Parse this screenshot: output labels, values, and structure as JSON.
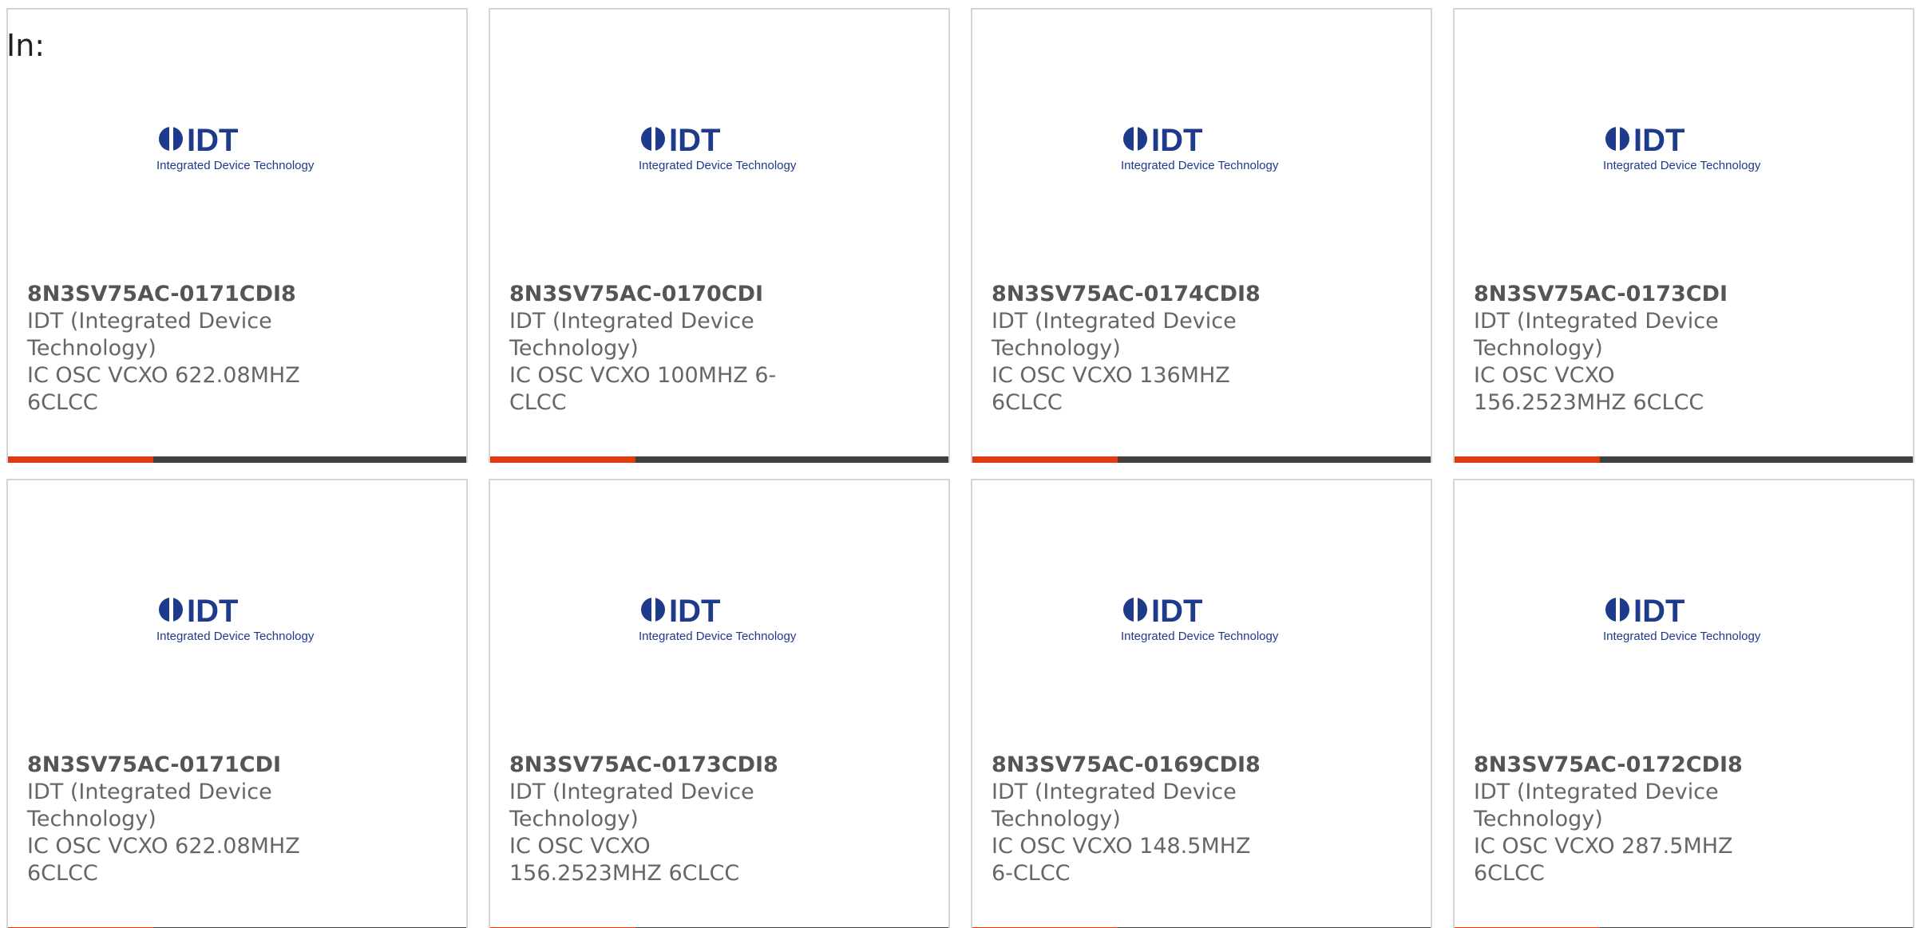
{
  "filter_label": "In:",
  "colors": {
    "accent": "#e03a10",
    "bar_dark": "#404040",
    "logo_blue": "#1e3a8a",
    "text_gray": "#666666"
  },
  "logo": {
    "icon": "idt-logo-icon",
    "wordmark": "IDT",
    "tagline": "Integrated Device Technology"
  },
  "products": [
    {
      "part_number": "8N3SV75AC-0171CDI8",
      "manufacturer": "IDT (Integrated Device Technology)",
      "description": "IC OSC VCXO 622.08MHZ 6CLCC"
    },
    {
      "part_number": "8N3SV75AC-0170CDI",
      "manufacturer": "IDT (Integrated Device Technology)",
      "description": "IC OSC VCXO 100MHZ 6-CLCC"
    },
    {
      "part_number": "8N3SV75AC-0174CDI8",
      "manufacturer": "IDT (Integrated Device Technology)",
      "description": "IC OSC VCXO 136MHZ 6CLCC"
    },
    {
      "part_number": "8N3SV75AC-0173CDI",
      "manufacturer": "IDT (Integrated Device Technology)",
      "description": "IC OSC VCXO 156.2523MHZ 6CLCC"
    },
    {
      "part_number": "8N3SV75AC-0171CDI",
      "manufacturer": "IDT (Integrated Device Technology)",
      "description": "IC OSC VCXO 622.08MHZ 6CLCC"
    },
    {
      "part_number": "8N3SV75AC-0173CDI8",
      "manufacturer": "IDT (Integrated Device Technology)",
      "description": "IC OSC VCXO 156.2523MHZ 6CLCC"
    },
    {
      "part_number": "8N3SV75AC-0169CDI8",
      "manufacturer": "IDT (Integrated Device Technology)",
      "description": "IC OSC VCXO 148.5MHZ 6-CLCC"
    },
    {
      "part_number": "8N3SV75AC-0172CDI8",
      "manufacturer": "IDT (Integrated Device Technology)",
      "description": "IC OSC VCXO 287.5MHZ 6CLCC"
    }
  ]
}
